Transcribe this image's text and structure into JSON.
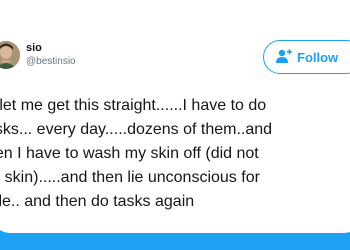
{
  "user": {
    "display_name": "sio",
    "handle": "@bestinsio",
    "avatar_icon": "user-avatar-photo"
  },
  "follow_button": {
    "label": "Follow",
    "icon": "add-user-icon",
    "color": "#1da1f2"
  },
  "tweet": {
    "text": "o let me get this straight......I have to do\nasks... every day.....dozens of them..and\nhen I have to wash my skin off (did not\nor skin).....and then lie unconscious for\nhile.. and then do tasks again"
  },
  "colors": {
    "background": "#1da1f2",
    "card": "#ffffff",
    "accent": "#1da1f2"
  }
}
